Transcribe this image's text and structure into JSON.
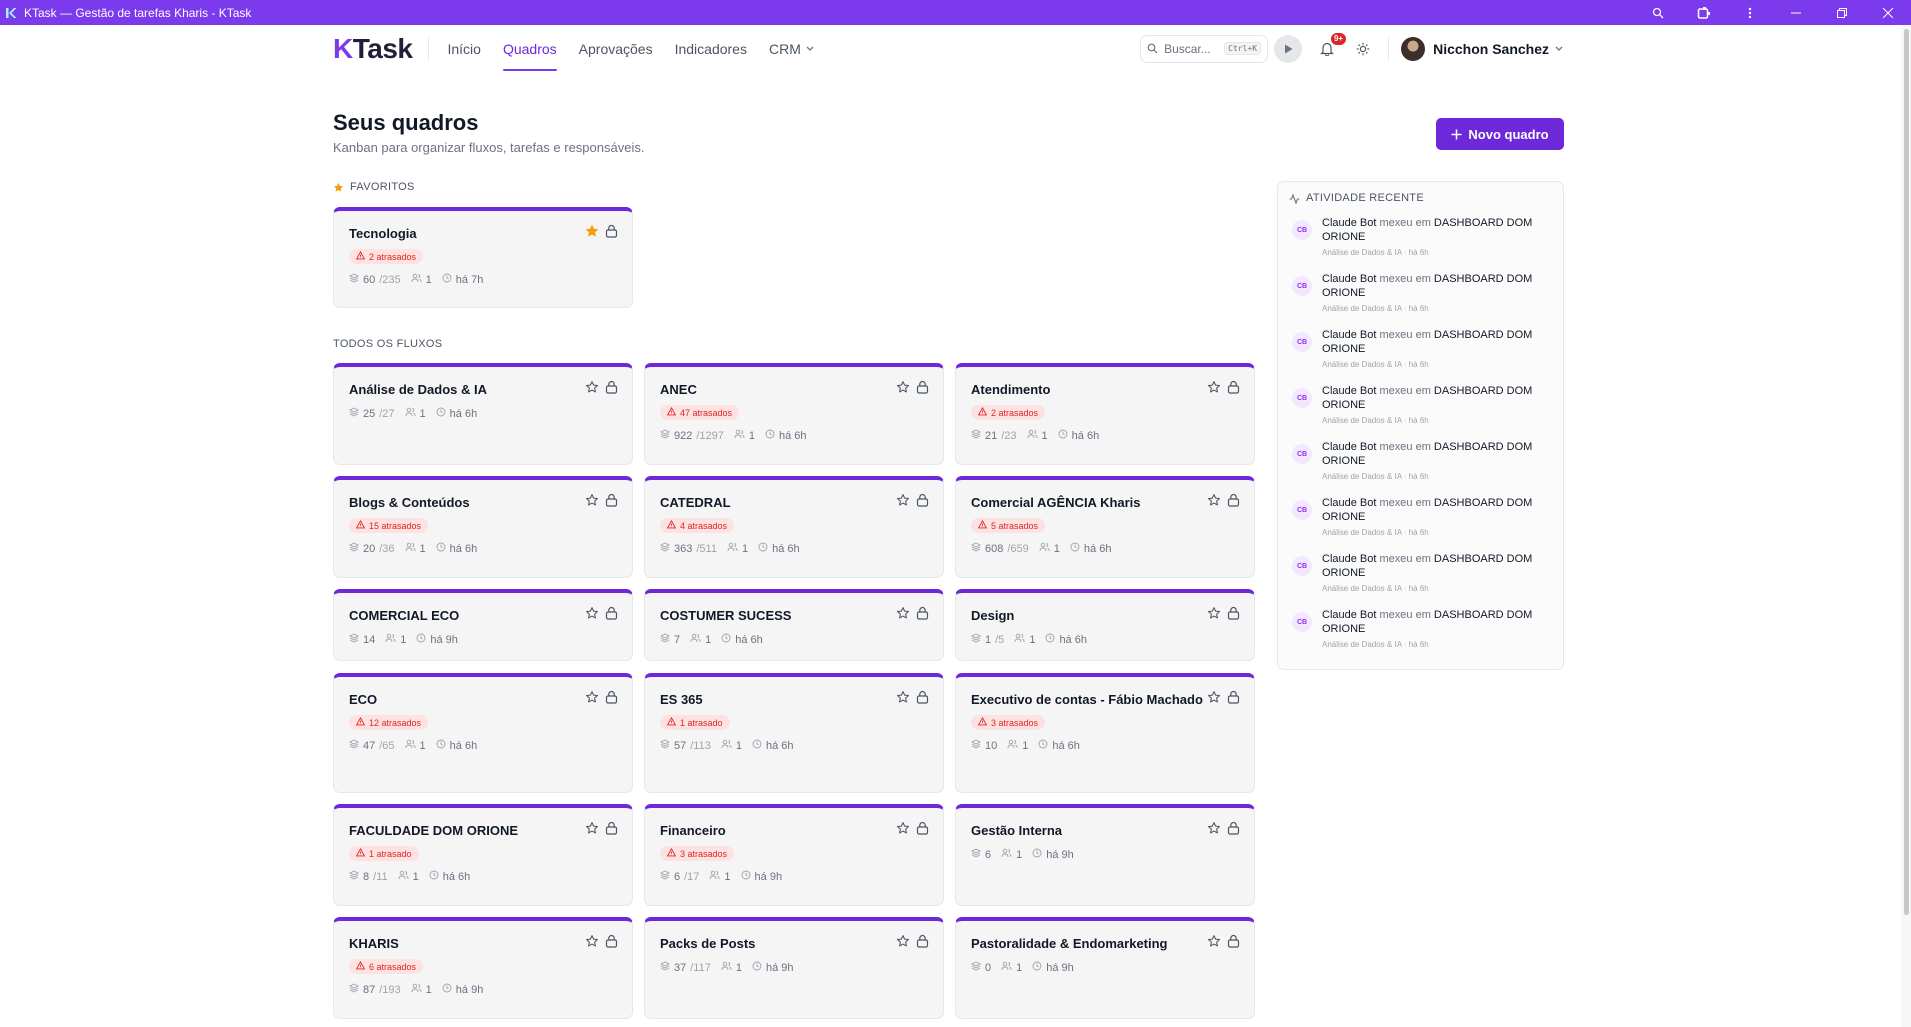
{
  "window": {
    "title": "KTask — Gestão de tarefas Kharis - KTask"
  },
  "nav": {
    "logo_k": "K",
    "logo_rest": "Task",
    "links": [
      {
        "label": "Início"
      },
      {
        "label": "Quadros",
        "active": true
      },
      {
        "label": "Aprovações"
      },
      {
        "label": "Indicadores"
      },
      {
        "label": "CRM"
      }
    ],
    "search_placeholder": "Buscar...",
    "search_shortcut": "Ctrl+K",
    "notif_count": "9+",
    "user_name": "Nicchon Sanchez"
  },
  "header": {
    "title": "Seus quadros",
    "subtitle": "Kanban para organizar fluxos, tarefas e responsáveis.",
    "new_button": "Novo quadro"
  },
  "favorites_label": "FAVORITOS",
  "all_label": "TODOS OS FLUXOS",
  "colors": {
    "accent": "#6d28d9",
    "brand": "#7c3aed",
    "late": "#dc2626"
  },
  "favorites": [
    {
      "title": "Tecnologia",
      "late": "2 atrasados",
      "done": "60",
      "total": "/235",
      "members": "1",
      "time": "há 7h",
      "starred": true
    }
  ],
  "boards": [
    {
      "title": "Análise de Dados & IA",
      "late": "",
      "done": "25",
      "total": "/27",
      "members": "1",
      "time": "há 6h"
    },
    {
      "title": "ANEC",
      "late": "47 atrasados",
      "done": "922",
      "total": "/1297",
      "members": "1",
      "time": "há 6h"
    },
    {
      "title": "Atendimento",
      "late": "2 atrasados",
      "done": "21",
      "total": "/23",
      "members": "1",
      "time": "há 6h"
    },
    {
      "title": "Blogs & Conteúdos",
      "late": "15 atrasados",
      "done": "20",
      "total": "/36",
      "members": "1",
      "time": "há 6h"
    },
    {
      "title": "CATEDRAL",
      "late": "4 atrasados",
      "done": "363",
      "total": "/511",
      "members": "1",
      "time": "há 6h"
    },
    {
      "title": "Comercial AGÊNCIA Kharis",
      "late": "5 atrasados",
      "done": "608",
      "total": "/659",
      "members": "1",
      "time": "há 6h"
    },
    {
      "title": "COMERCIAL ECO",
      "late": "",
      "done": "14",
      "total": "",
      "members": "1",
      "time": "há 9h"
    },
    {
      "title": "COSTUMER SUCESS",
      "late": "",
      "done": "7",
      "total": "",
      "members": "1",
      "time": "há 6h"
    },
    {
      "title": "Design",
      "late": "",
      "done": "1",
      "total": "/5",
      "members": "1",
      "time": "há 6h"
    },
    {
      "title": "ECO",
      "late": "12 atrasados",
      "done": "47",
      "total": "/65",
      "members": "1",
      "time": "há 6h"
    },
    {
      "title": "ES 365",
      "late": "1 atrasado",
      "done": "57",
      "total": "/113",
      "members": "1",
      "time": "há 6h"
    },
    {
      "title": "Executivo de contas - Fábio Machado",
      "late": "3 atrasados",
      "done": "10",
      "total": "",
      "members": "1",
      "time": "há 6h"
    },
    {
      "title": "FACULDADE DOM ORIONE",
      "late": "1 atrasado",
      "done": "8",
      "total": "/11",
      "members": "1",
      "time": "há 6h"
    },
    {
      "title": "Financeiro",
      "late": "3 atrasados",
      "done": "6",
      "total": "/17",
      "members": "1",
      "time": "há 9h"
    },
    {
      "title": "Gestão Interna",
      "late": "",
      "done": "6",
      "total": "",
      "members": "1",
      "time": "há 9h"
    },
    {
      "title": "KHARIS",
      "late": "6 atrasados",
      "done": "87",
      "total": "/193",
      "members": "1",
      "time": "há 9h"
    },
    {
      "title": "Packs de Posts",
      "late": "",
      "done": "37",
      "total": "/117",
      "members": "1",
      "time": "há 9h"
    },
    {
      "title": "Pastoralidade & Endomarketing",
      "late": "",
      "done": "0",
      "total": "",
      "members": "1",
      "time": "há 9h"
    }
  ],
  "activity": {
    "title": "ATIVIDADE RECENTE",
    "items": [
      {
        "initials": "CB",
        "actor": "Claude Bot",
        "verb": "mexeu em",
        "target": "DASHBOARD DOM ORIONE",
        "meta": "Análise de Dados & IA · há 6h"
      },
      {
        "initials": "CB",
        "actor": "Claude Bot",
        "verb": "mexeu em",
        "target": "DASHBOARD DOM ORIONE",
        "meta": "Análise de Dados & IA · há 6h"
      },
      {
        "initials": "CB",
        "actor": "Claude Bot",
        "verb": "mexeu em",
        "target": "DASHBOARD DOM ORIONE",
        "meta": "Análise de Dados & IA · há 6h"
      },
      {
        "initials": "CB",
        "actor": "Claude Bot",
        "verb": "mexeu em",
        "target": "DASHBOARD DOM ORIONE",
        "meta": "Análise de Dados & IA · há 6h"
      },
      {
        "initials": "CB",
        "actor": "Claude Bot",
        "verb": "mexeu em",
        "target": "DASHBOARD DOM ORIONE",
        "meta": "Análise de Dados & IA · há 6h"
      },
      {
        "initials": "CB",
        "actor": "Claude Bot",
        "verb": "mexeu em",
        "target": "DASHBOARD DOM ORIONE",
        "meta": "Análise de Dados & IA · há 6h"
      },
      {
        "initials": "CB",
        "actor": "Claude Bot",
        "verb": "mexeu em",
        "target": "DASHBOARD DOM ORIONE",
        "meta": "Análise de Dados & IA · há 6h"
      },
      {
        "initials": "CB",
        "actor": "Claude Bot",
        "verb": "mexeu em",
        "target": "DASHBOARD DOM ORIONE",
        "meta": "Análise de Dados & IA · há 6h"
      }
    ]
  }
}
